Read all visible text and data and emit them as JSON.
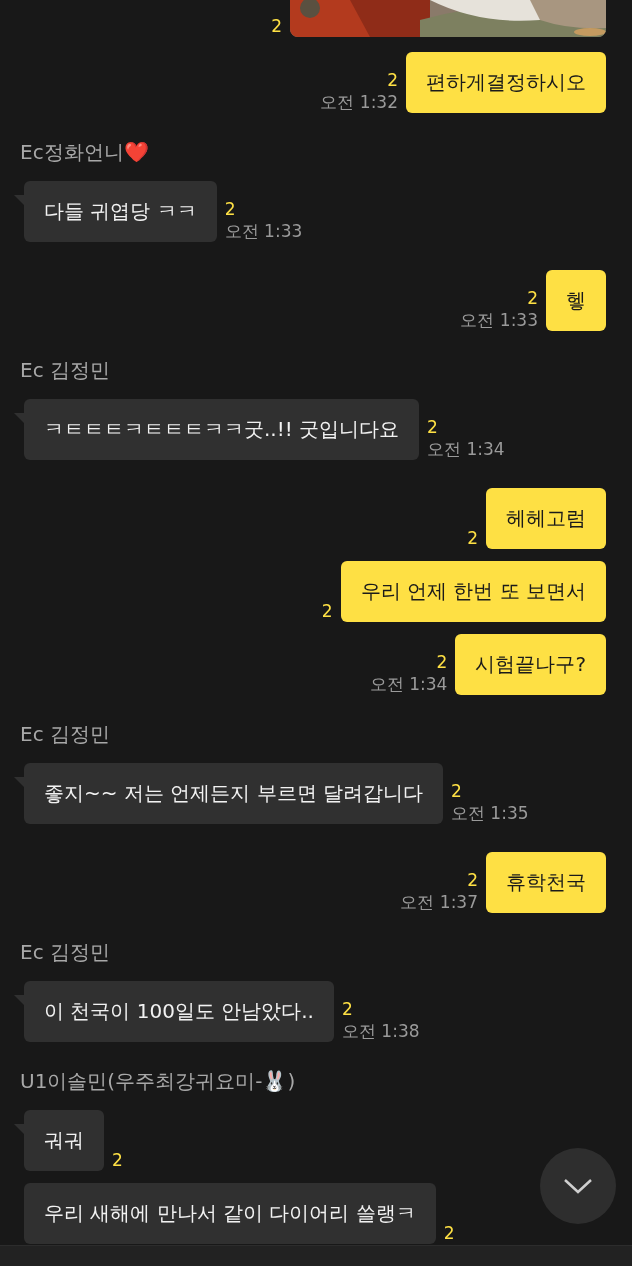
{
  "messages": [
    {
      "unread": "2"
    },
    {
      "kind": "sent",
      "tail": false,
      "text": "편하게결정하시오",
      "unread": "2",
      "time": "오전 1:32"
    },
    {
      "kind": "name",
      "text": "Ec정화언니❤️"
    },
    {
      "kind": "received",
      "tail": true,
      "text": "다들 귀엽당 ㅋㅋ",
      "unread": "2",
      "time": "오전 1:33"
    },
    {
      "kind": "sent",
      "tail": false,
      "text": "헿",
      "unread": "2",
      "time": "오전 1:33"
    },
    {
      "kind": "name",
      "text": "Ec 김정민"
    },
    {
      "kind": "received",
      "tail": true,
      "text": "ㅋㅌㅌㅌㅋㅌㅌㅌㅋㅋ굿..!! 굿입니다요",
      "unread": "2",
      "time": "오전 1:34"
    },
    {
      "kind": "sent",
      "tail": false,
      "text": "헤헤고럼",
      "unread": "2"
    },
    {
      "kind": "sent",
      "tail": false,
      "text": "우리 언제 한번 또 보면서",
      "unread": "2"
    },
    {
      "kind": "sent",
      "tail": false,
      "text": "시험끝나구?",
      "unread": "2",
      "time": "오전 1:34"
    },
    {
      "kind": "name",
      "text": "Ec 김정민"
    },
    {
      "kind": "received",
      "tail": true,
      "text": "좋지~~ 저는 언제든지 부르면 달려갑니다",
      "unread": "2",
      "time": "오전 1:35"
    },
    {
      "kind": "sent",
      "tail": false,
      "text": "휴학천국",
      "unread": "2",
      "time": "오전 1:37"
    },
    {
      "kind": "name",
      "text": "Ec 김정민"
    },
    {
      "kind": "received",
      "tail": true,
      "text": "이 천국이 100일도 안남았다..",
      "unread": "2",
      "time": "오전 1:38"
    },
    {
      "kind": "name",
      "text": "U1이솔민(우주최강귀요미-🐰)"
    },
    {
      "kind": "received",
      "tail": true,
      "text": "궈궈",
      "unread": "2"
    },
    {
      "kind": "received",
      "tail": false,
      "text": "우리 새해에 만나서 같이 다이어리 쓸랭ㅋ",
      "unread": "2"
    }
  ]
}
